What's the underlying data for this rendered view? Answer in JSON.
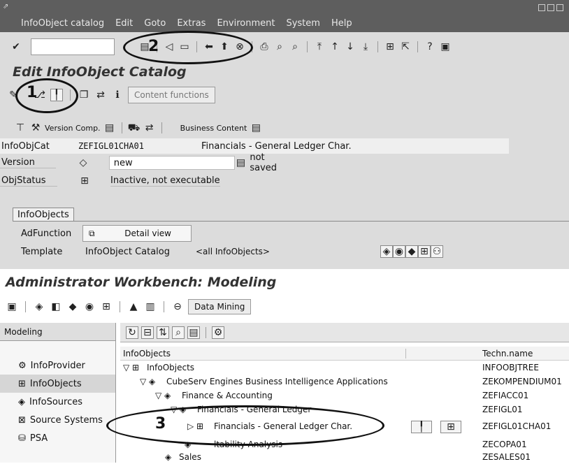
{
  "menubar": {
    "items": [
      "InfoObject catalog",
      "Edit",
      "Goto",
      "Extras",
      "Environment",
      "System",
      "Help"
    ]
  },
  "page_title": "Edit InfoObject Catalog",
  "app_toolbar": {
    "content_functions": "Content functions"
  },
  "sub_toolbar": {
    "version_comp": "Version Comp.",
    "business_content": "Business Content"
  },
  "fields": {
    "infoobjcat_label": "InfoObjCat",
    "infoobjcat_value": "ZEFIGL01CHA01",
    "infoobjcat_desc": "Financials - General Ledger Char.",
    "version_label": "Version",
    "version_value": "new",
    "version_status": "not saved",
    "objstatus_label": "ObjStatus",
    "objstatus_value": "Inactive, not executable"
  },
  "infoobjects_tab": {
    "label": "InfoObjects",
    "adfunction_label": "AdFunction",
    "detail_view": "Detail view",
    "template_label": "Template",
    "template_value": "InfoObject Catalog",
    "template_field": "<all InfoObjects>"
  },
  "awb": {
    "title": "Administrator Workbench: Modeling",
    "data_mining": "Data Mining"
  },
  "left_pane": {
    "header": "Modeling",
    "items": [
      "InfoProvider",
      "InfoObjects",
      "InfoSources",
      "Source Systems",
      "PSA"
    ]
  },
  "tree": {
    "col_infoobjects": "InfoObjects",
    "col_techn": "Techn.name",
    "rows": [
      {
        "label": "InfoObjects",
        "tech": "INFOOBJTREE"
      },
      {
        "label": "CubeServ Engines Business Intelligence Applications",
        "tech": "ZEKOMPENDIUM01"
      },
      {
        "label": "Finance & Accounting",
        "tech": "ZEFIACC01"
      },
      {
        "label": "Financials - General Ledger",
        "tech": "ZEFIGL01"
      },
      {
        "label": "Financials - General Ledger Char.",
        "tech": "ZEFIGL01CHA01"
      },
      {
        "label": "ltability Analysis",
        "tech": "ZECOPA01"
      },
      {
        "label": "Sales",
        "tech": "ZESALES01"
      }
    ]
  },
  "callouts": {
    "n1": "1",
    "n2": "2",
    "n3": "3"
  }
}
